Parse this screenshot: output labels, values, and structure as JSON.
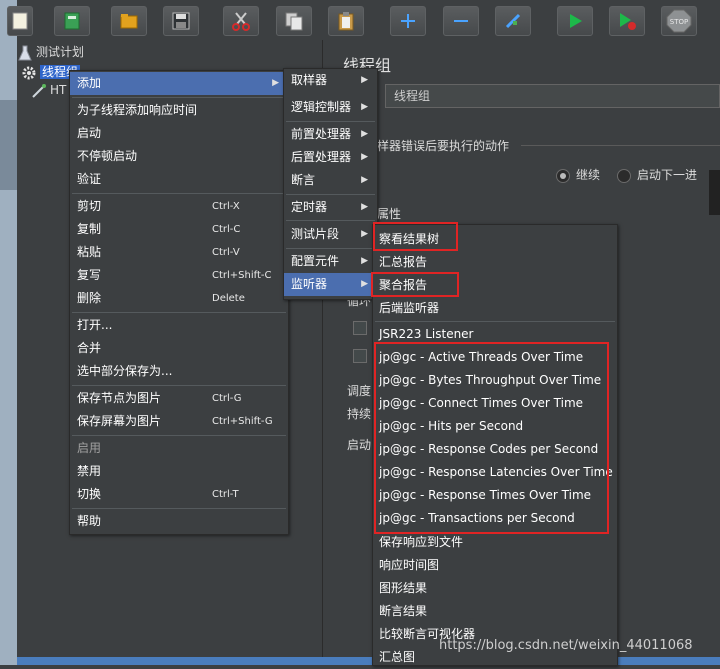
{
  "tree": {
    "test_plan": "测试计划",
    "thread_group": "线程组",
    "http_child": "HT"
  },
  "panel": {
    "title": "线程组",
    "name_value": "线程组",
    "on_error_label": "样器错误后要执行的动作",
    "opt_continue": "继续",
    "opt_next_loop": "启动下一进",
    "attr_label": "属性",
    "loop_label": "循环",
    "scheduler_label": "调度",
    "duration_label": "持续",
    "delay_label": "启动"
  },
  "context_menu": {
    "items": [
      {
        "label": "添加",
        "submenu": true
      },
      {
        "label": "为子线程添加响应时间"
      },
      {
        "label": "启动"
      },
      {
        "label": "不停顿启动"
      },
      {
        "label": "验证"
      },
      {
        "label": "剪切",
        "accel": "Ctrl-X"
      },
      {
        "label": "复制",
        "accel": "Ctrl-C"
      },
      {
        "label": "粘贴",
        "accel": "Ctrl-V"
      },
      {
        "label": "复写",
        "accel": "Ctrl+Shift-C"
      },
      {
        "label": "删除",
        "accel": "Delete"
      },
      {
        "label": "打开..."
      },
      {
        "label": "合并"
      },
      {
        "label": "选中部分保存为..."
      },
      {
        "label": "保存节点为图片",
        "accel": "Ctrl-G"
      },
      {
        "label": "保存屏幕为图片",
        "accel": "Ctrl+Shift-G"
      },
      {
        "label": "启用"
      },
      {
        "label": "禁用"
      },
      {
        "label": "切换",
        "accel": "Ctrl-T"
      },
      {
        "label": "帮助"
      }
    ]
  },
  "add_menu": {
    "items": [
      {
        "label": "取样器"
      },
      {
        "label": "逻辑控制器"
      },
      {
        "label": "前置处理器"
      },
      {
        "label": "后置处理器"
      },
      {
        "label": "断言"
      },
      {
        "label": "定时器"
      },
      {
        "label": "测试片段"
      },
      {
        "label": "配置元件"
      },
      {
        "label": "监听器"
      }
    ]
  },
  "listener_menu": {
    "items": [
      {
        "label": "察看结果树"
      },
      {
        "label": "汇总报告"
      },
      {
        "label": "聚合报告"
      },
      {
        "label": "后端监听器"
      },
      {
        "label": "JSR223 Listener"
      },
      {
        "label": "jp@gc - Active Threads Over Time"
      },
      {
        "label": "jp@gc - Bytes Throughput Over Time"
      },
      {
        "label": "jp@gc - Connect Times Over Time"
      },
      {
        "label": "jp@gc - Hits per Second"
      },
      {
        "label": "jp@gc - Response Codes per Second"
      },
      {
        "label": "jp@gc - Response Latencies Over Time"
      },
      {
        "label": "jp@gc - Response Times Over Time"
      },
      {
        "label": "jp@gc - Transactions per Second"
      },
      {
        "label": "保存响应到文件"
      },
      {
        "label": "响应时间图"
      },
      {
        "label": "图形结果"
      },
      {
        "label": "断言结果"
      },
      {
        "label": "比较断言可视化器"
      },
      {
        "label": "汇总图"
      }
    ]
  },
  "toolbar": {
    "icons": [
      "new-icon",
      "templates-icon",
      "open-icon",
      "save-icon",
      "cut-icon",
      "copy-icon",
      "paste-icon",
      "expand-icon",
      "collapse-icon",
      "toggle-icon",
      "start-icon",
      "start-no-pause-icon",
      "stop-icon"
    ],
    "stop_text": "STOP"
  },
  "colors": {
    "menu_bg": "#3c3f41",
    "highlight": "#4b6eaf",
    "annotation_red": "#e02424"
  },
  "watermark": "https://blog.csdn.net/weixin_44011068"
}
